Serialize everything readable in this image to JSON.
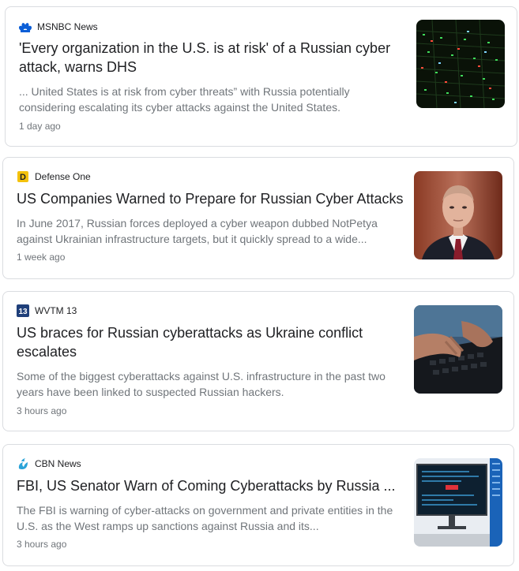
{
  "articles": [
    {
      "source": "MSNBC News",
      "source_icon": "msnbc-peacock-icon",
      "headline": "'Every organization in the U.S. is at risk' of a Russian cyber attack, warns DHS",
      "snippet": "... United States is at risk from cyber threats” with Russia potentially considering escalating its cyber attacks against the United States.",
      "time": "1 day ago",
      "thumbnail": "server-rack-lights-image"
    },
    {
      "source": "Defense One",
      "source_icon": "defense-one-d-icon",
      "headline": "US Companies Warned to Prepare for Russian Cyber Attacks",
      "snippet": "In June 2017, Russian forces deployed a cyber weapon dubbed NotPetya against Ukrainian infrastructure targets, but it quickly spread to a wide...",
      "time": "1 week ago",
      "thumbnail": "man-in-suit-portrait-image"
    },
    {
      "source": "WVTM 13",
      "source_icon": "wvtm13-logo-icon",
      "headline": "US braces for Russian cyberattacks as Ukraine conflict escalates",
      "snippet": "Some of the biggest cyberattacks against U.S. infrastructure in the past two years have been linked to suspected Russian hackers.",
      "time": "3 hours ago",
      "thumbnail": "hands-typing-keyboard-image"
    },
    {
      "source": "CBN News",
      "source_icon": "cbn-flame-icon",
      "headline": "FBI, US Senator Warn of Coming Cyberattacks by Russia ...",
      "snippet": "The FBI is warning of cyber-attacks on government and private entities in the U.S. as the West ramps up sanctions against Russia and its...",
      "time": "3 hours ago",
      "thumbnail": "computer-monitor-alert-image"
    }
  ],
  "colors": {
    "border": "#dadce0",
    "headline": "#202124",
    "snippet": "#70757a",
    "msnbc_blue": "#0b5ed7",
    "defense_one_yellow": "#f4c20d",
    "wvtm_blue": "#1f3f7a",
    "cbn_blue": "#2aa3d8"
  }
}
